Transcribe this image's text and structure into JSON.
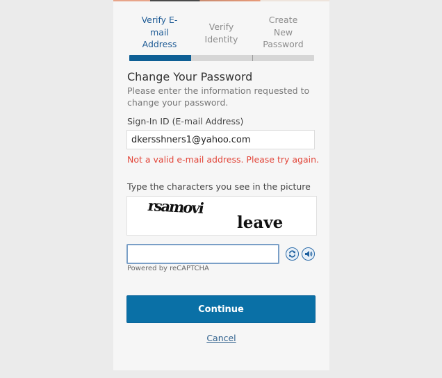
{
  "steps": [
    {
      "label": "Verify E-mail Address",
      "lines": [
        "Verify E-",
        "mail",
        "Address"
      ],
      "active": true
    },
    {
      "label": "Verify Identity",
      "lines": [
        "Verify",
        "Identity"
      ],
      "active": false
    },
    {
      "label": "Create New Password",
      "lines": [
        "Create",
        "New",
        "Password"
      ],
      "active": false
    }
  ],
  "progress": {
    "current_step": 1,
    "total_steps": 3,
    "fraction": 0.333
  },
  "form": {
    "title": "Change Your Password",
    "subtitle": "Please enter the information requested to change your password.",
    "email_label": "Sign-In ID (E-mail Address)",
    "email_value": "dkersshners1@yahoo.com",
    "error_message": "Not a valid e-mail address. Please try again."
  },
  "captcha": {
    "label": "Type the characters you see in the picture",
    "image_words": [
      "rsamovi",
      "leave"
    ],
    "input_value": "",
    "reload_icon": "refresh-icon",
    "audio_icon": "speaker-icon",
    "powered_by": "Powered by reCAPTCHA"
  },
  "actions": {
    "continue_label": "Continue",
    "cancel_label": "Cancel"
  },
  "colors": {
    "accent": "#0a70a6",
    "active_step": "#1f5c96",
    "error": "#e2473b",
    "link": "#2e5f8c"
  }
}
